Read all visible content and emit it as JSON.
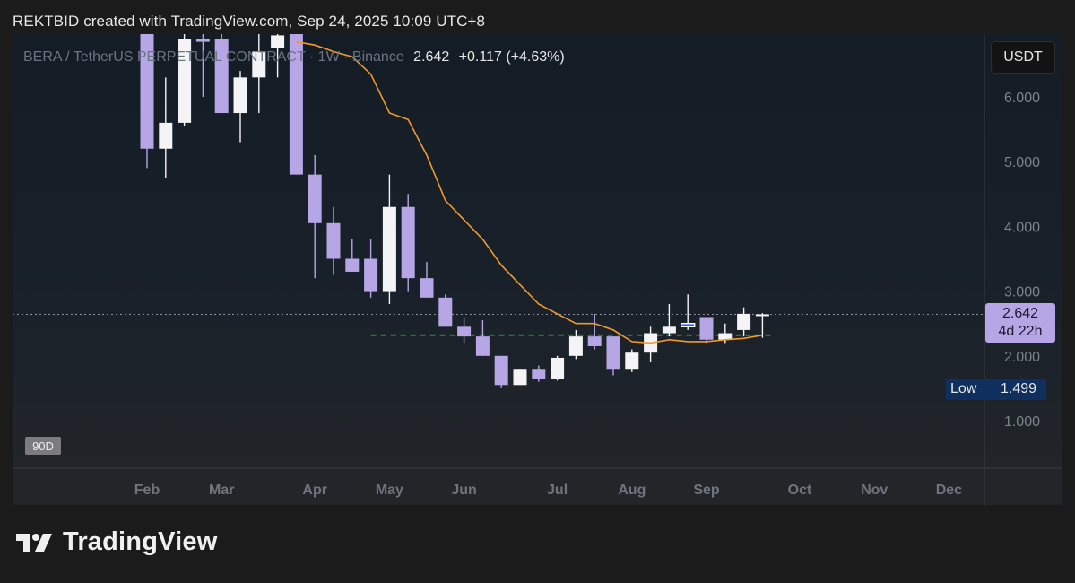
{
  "header": {
    "attribution": "REKTBID created with TradingView.com, Sep 24, 2025 10:09 UTC+8"
  },
  "symbol": {
    "title": "BERA / TetherUS PERPETUAL CONTRACT · 1W · Binance",
    "price": "2.642",
    "change": "+0.117 (+4.63%)"
  },
  "currency_button": "USDT",
  "last_price": {
    "value": "2.642",
    "countdown": "4d 22h"
  },
  "low_marker": {
    "label": "Low",
    "value": "1.499"
  },
  "range_button": "90D",
  "logo": {
    "text": "TradingView",
    "icon": "tradingview-logo-icon"
  },
  "colors": {
    "up": "#f4f4f6",
    "down": "#b6a6e6",
    "ma": "#f09a2a",
    "support": "#31c431",
    "highlight": "#2962ff"
  },
  "chart_data": {
    "type": "candlestick",
    "title": "BERA / TetherUS PERPETUAL CONTRACT · 1W · Binance",
    "interval": "1W",
    "y_ticks": [
      "6.000",
      "5.000",
      "4.000",
      "3.000",
      "2.000",
      "1.000"
    ],
    "ylim": [
      0.35,
      6.95
    ],
    "x_tick_labels": [
      "Feb",
      "Mar",
      "Apr",
      "May",
      "Jun",
      "Jul",
      "Aug",
      "Sep",
      "Oct",
      "Nov",
      "Dec"
    ],
    "x_tick_index": [
      0.0,
      4.0,
      9.0,
      13.0,
      17.0,
      22.0,
      26.0,
      30.0,
      35.0,
      39.0,
      43.0
    ],
    "candles": [
      {
        "i": 0,
        "o": 7.5,
        "h": 7.6,
        "l": 4.9,
        "c": 5.2
      },
      {
        "i": 1,
        "o": 5.2,
        "h": 6.3,
        "l": 4.75,
        "c": 5.6
      },
      {
        "i": 2,
        "o": 5.6,
        "h": 7.3,
        "l": 5.55,
        "c": 6.9
      },
      {
        "i": 3,
        "o": 6.9,
        "h": 7.2,
        "l": 6.0,
        "c": 6.85
      },
      {
        "i": 4,
        "o": 6.9,
        "h": 7.1,
        "l": 5.75,
        "c": 5.75
      },
      {
        "i": 5,
        "o": 5.75,
        "h": 6.4,
        "l": 5.3,
        "c": 6.3
      },
      {
        "i": 6,
        "o": 6.3,
        "h": 7.0,
        "l": 5.75,
        "c": 6.7
      },
      {
        "i": 7,
        "o": 6.75,
        "h": 7.2,
        "l": 6.3,
        "c": 6.95
      },
      {
        "i": 8,
        "o": 7.0,
        "h": 7.1,
        "l": 4.8,
        "c": 4.8
      },
      {
        "i": 9,
        "o": 4.8,
        "h": 5.1,
        "l": 3.2,
        "c": 4.05
      },
      {
        "i": 10,
        "o": 4.05,
        "h": 4.3,
        "l": 3.25,
        "c": 3.5
      },
      {
        "i": 11,
        "o": 3.5,
        "h": 3.8,
        "l": 3.3,
        "c": 3.3
      },
      {
        "i": 12,
        "o": 3.5,
        "h": 3.8,
        "l": 2.9,
        "c": 3.0
      },
      {
        "i": 13,
        "o": 3.0,
        "h": 4.8,
        "l": 2.8,
        "c": 4.3
      },
      {
        "i": 14,
        "o": 4.3,
        "h": 4.5,
        "l": 3.0,
        "c": 3.2
      },
      {
        "i": 15,
        "o": 3.2,
        "h": 3.45,
        "l": 2.9,
        "c": 2.9
      },
      {
        "i": 16,
        "o": 2.9,
        "h": 2.95,
        "l": 2.45,
        "c": 2.45
      },
      {
        "i": 17,
        "o": 2.45,
        "h": 2.6,
        "l": 2.2,
        "c": 2.3
      },
      {
        "i": 18,
        "o": 2.3,
        "h": 2.55,
        "l": 2.0,
        "c": 2.0
      },
      {
        "i": 19,
        "o": 2.0,
        "h": 2.0,
        "l": 1.5,
        "c": 1.55
      },
      {
        "i": 20,
        "o": 1.55,
        "h": 1.8,
        "l": 1.55,
        "c": 1.8
      },
      {
        "i": 21,
        "o": 1.8,
        "h": 1.85,
        "l": 1.6,
        "c": 1.65
      },
      {
        "i": 22,
        "o": 1.65,
        "h": 2.0,
        "l": 1.62,
        "c": 1.97
      },
      {
        "i": 23,
        "o": 2.0,
        "h": 2.4,
        "l": 1.95,
        "c": 2.3
      },
      {
        "i": 24,
        "o": 2.3,
        "h": 2.65,
        "l": 2.1,
        "c": 2.15
      },
      {
        "i": 25,
        "o": 2.3,
        "h": 2.3,
        "l": 1.7,
        "c": 1.8
      },
      {
        "i": 26,
        "o": 1.8,
        "h": 2.1,
        "l": 1.75,
        "c": 2.05
      },
      {
        "i": 27,
        "o": 2.05,
        "h": 2.45,
        "l": 1.9,
        "c": 2.35
      },
      {
        "i": 28,
        "o": 2.35,
        "h": 2.8,
        "l": 2.3,
        "c": 2.45
      },
      {
        "i": 29,
        "o": 2.45,
        "h": 2.95,
        "l": 2.4,
        "c": 2.5
      },
      {
        "i": 30,
        "o": 2.6,
        "h": 2.6,
        "l": 2.2,
        "c": 2.25
      },
      {
        "i": 31,
        "o": 2.25,
        "h": 2.5,
        "l": 2.2,
        "c": 2.35
      },
      {
        "i": 32,
        "o": 2.4,
        "h": 2.75,
        "l": 2.3,
        "c": 2.65
      },
      {
        "i": 33,
        "o": 2.62,
        "h": 2.66,
        "l": 2.28,
        "c": 2.642
      }
    ],
    "highlighted_candle_index": 29,
    "moving_average": {
      "type": "line",
      "values": [
        [
          8,
          6.85
        ],
        [
          9,
          6.8
        ],
        [
          10,
          6.7
        ],
        [
          11,
          6.62
        ],
        [
          12,
          6.35
        ],
        [
          13,
          5.75
        ],
        [
          14,
          5.65
        ],
        [
          15,
          5.1
        ],
        [
          16,
          4.4
        ],
        [
          17,
          4.1
        ],
        [
          18,
          3.8
        ],
        [
          19,
          3.4
        ],
        [
          20,
          3.1
        ],
        [
          21,
          2.8
        ],
        [
          22,
          2.65
        ],
        [
          23,
          2.5
        ],
        [
          24,
          2.5
        ],
        [
          25,
          2.4
        ],
        [
          26,
          2.22
        ],
        [
          27,
          2.2
        ],
        [
          28,
          2.25
        ],
        [
          29,
          2.22
        ],
        [
          30,
          2.22
        ],
        [
          31,
          2.25
        ],
        [
          32,
          2.27
        ],
        [
          33,
          2.32
        ]
      ]
    },
    "horizontal_levels": [
      {
        "style": "dashed",
        "value": 2.32,
        "from_index": 12,
        "to_index": 33
      },
      {
        "style": "dotted",
        "value": 2.642
      }
    ],
    "low_value": 1.499,
    "last_value": 2.642,
    "countdown": "4d 22h",
    "currency": "USDT"
  }
}
